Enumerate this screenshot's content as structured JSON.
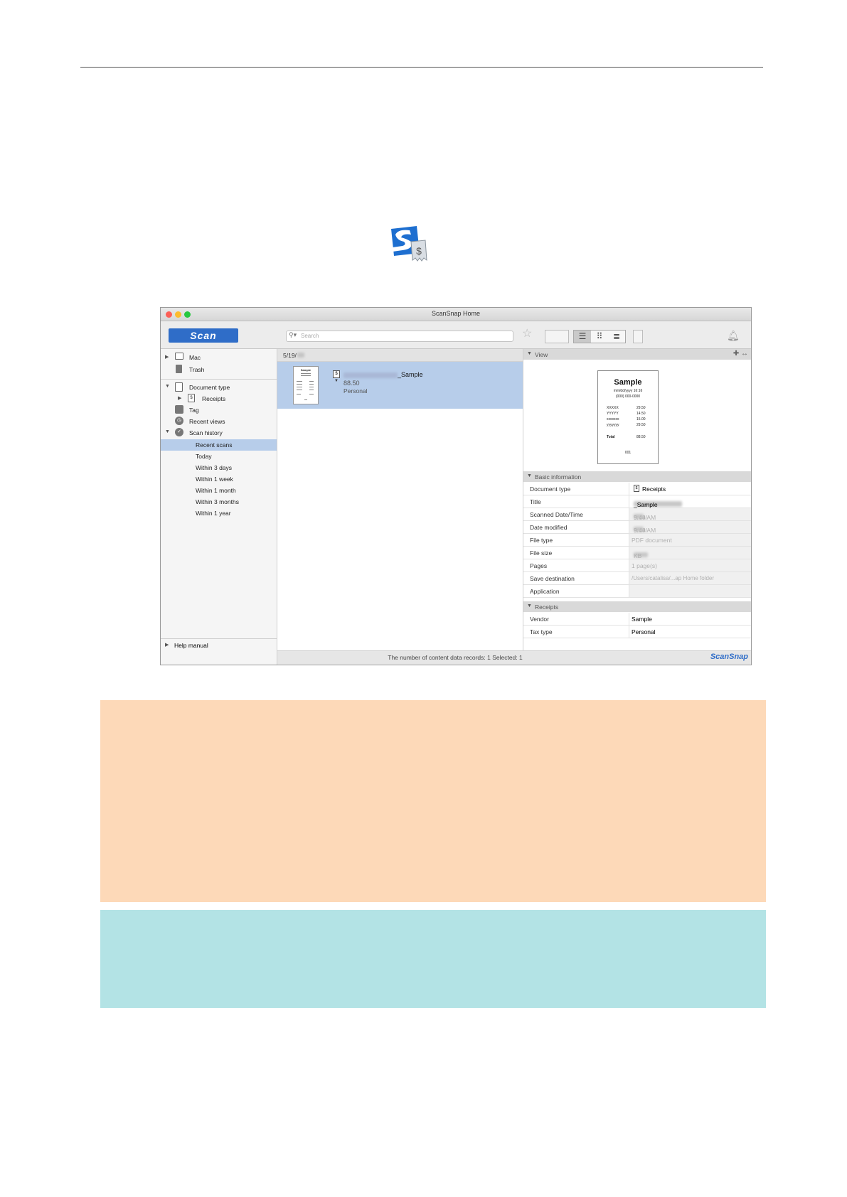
{
  "app_icon": {
    "name": "scansnap-receipt-app-icon"
  },
  "window": {
    "title": "ScanSnap Home",
    "traffic_light_colors": [
      "#fc5f57",
      "#fdbc2e",
      "#28c840"
    ]
  },
  "toolbar": {
    "scan_label": "Scan",
    "search_placeholder": "Search",
    "brand_color": "#2f6dc8"
  },
  "sidebar": {
    "mac": "Mac",
    "trash": "Trash",
    "document_type": "Document type",
    "receipts": "Receipts",
    "tag": "Tag",
    "recent_views": "Recent views",
    "scan_history": "Scan history",
    "history_items": [
      "Recent scans",
      "Today",
      "Within 3 days",
      "Within 1 week",
      "Within 1 month",
      "Within 3 months",
      "Within 1 year"
    ],
    "selected": "Recent scans",
    "help_manual": "Help manual"
  },
  "list": {
    "date_header": "5/19/",
    "item": {
      "title_suffix": "_Sample",
      "amount": "88.50",
      "category": "Personal",
      "thumb_title": "Sample"
    }
  },
  "view_panel": {
    "header": "View",
    "receipt": {
      "title": "Sample",
      "date_line": "mm/dd/yyyy  16:16",
      "phone": "(000) 000-0000",
      "items": [
        {
          "name": "XXXXX",
          "price": "29.50"
        },
        {
          "name": "YYYYY",
          "price": "14.50"
        },
        {
          "name": "xxxxxxx",
          "price": "15.00"
        },
        {
          "name": "yyyyyyy",
          "price": "29.50"
        }
      ],
      "total_label": "Total",
      "total_value": "88.50",
      "footer": "001"
    }
  },
  "basic_info": {
    "header": "Basic information",
    "document_type_label": "Document type",
    "document_type_value": "Receipts",
    "title_label": "Title",
    "title_value": "_Sample",
    "scanned_label": "Scanned Date/Time",
    "scanned_prefix": "5/19/",
    "scanned_time": "9:44 AM",
    "modified_label": "Date modified",
    "modified_prefix": "5/19/",
    "modified_time": "9:44 AM",
    "file_type_label": "File type",
    "file_type_value": "PDF document",
    "file_size_label": "File size",
    "file_size_unit": "KB",
    "pages_label": "Pages",
    "pages_value": "1 page(s)",
    "save_dest_label": "Save destination",
    "save_dest_value": "/Users/catalisa/...ap Home folder",
    "application_label": "Application"
  },
  "receipts_info": {
    "header": "Receipts",
    "vendor_label": "Vendor",
    "vendor_value": "Sample",
    "tax_label": "Tax type",
    "tax_value": "Personal"
  },
  "status_bar": {
    "text": "The number of content data records: 1  Selected: 1",
    "brand": "ScanSnap"
  },
  "boxes": {
    "orange": "#fdd9b8",
    "blue": "#b3e3e5"
  }
}
